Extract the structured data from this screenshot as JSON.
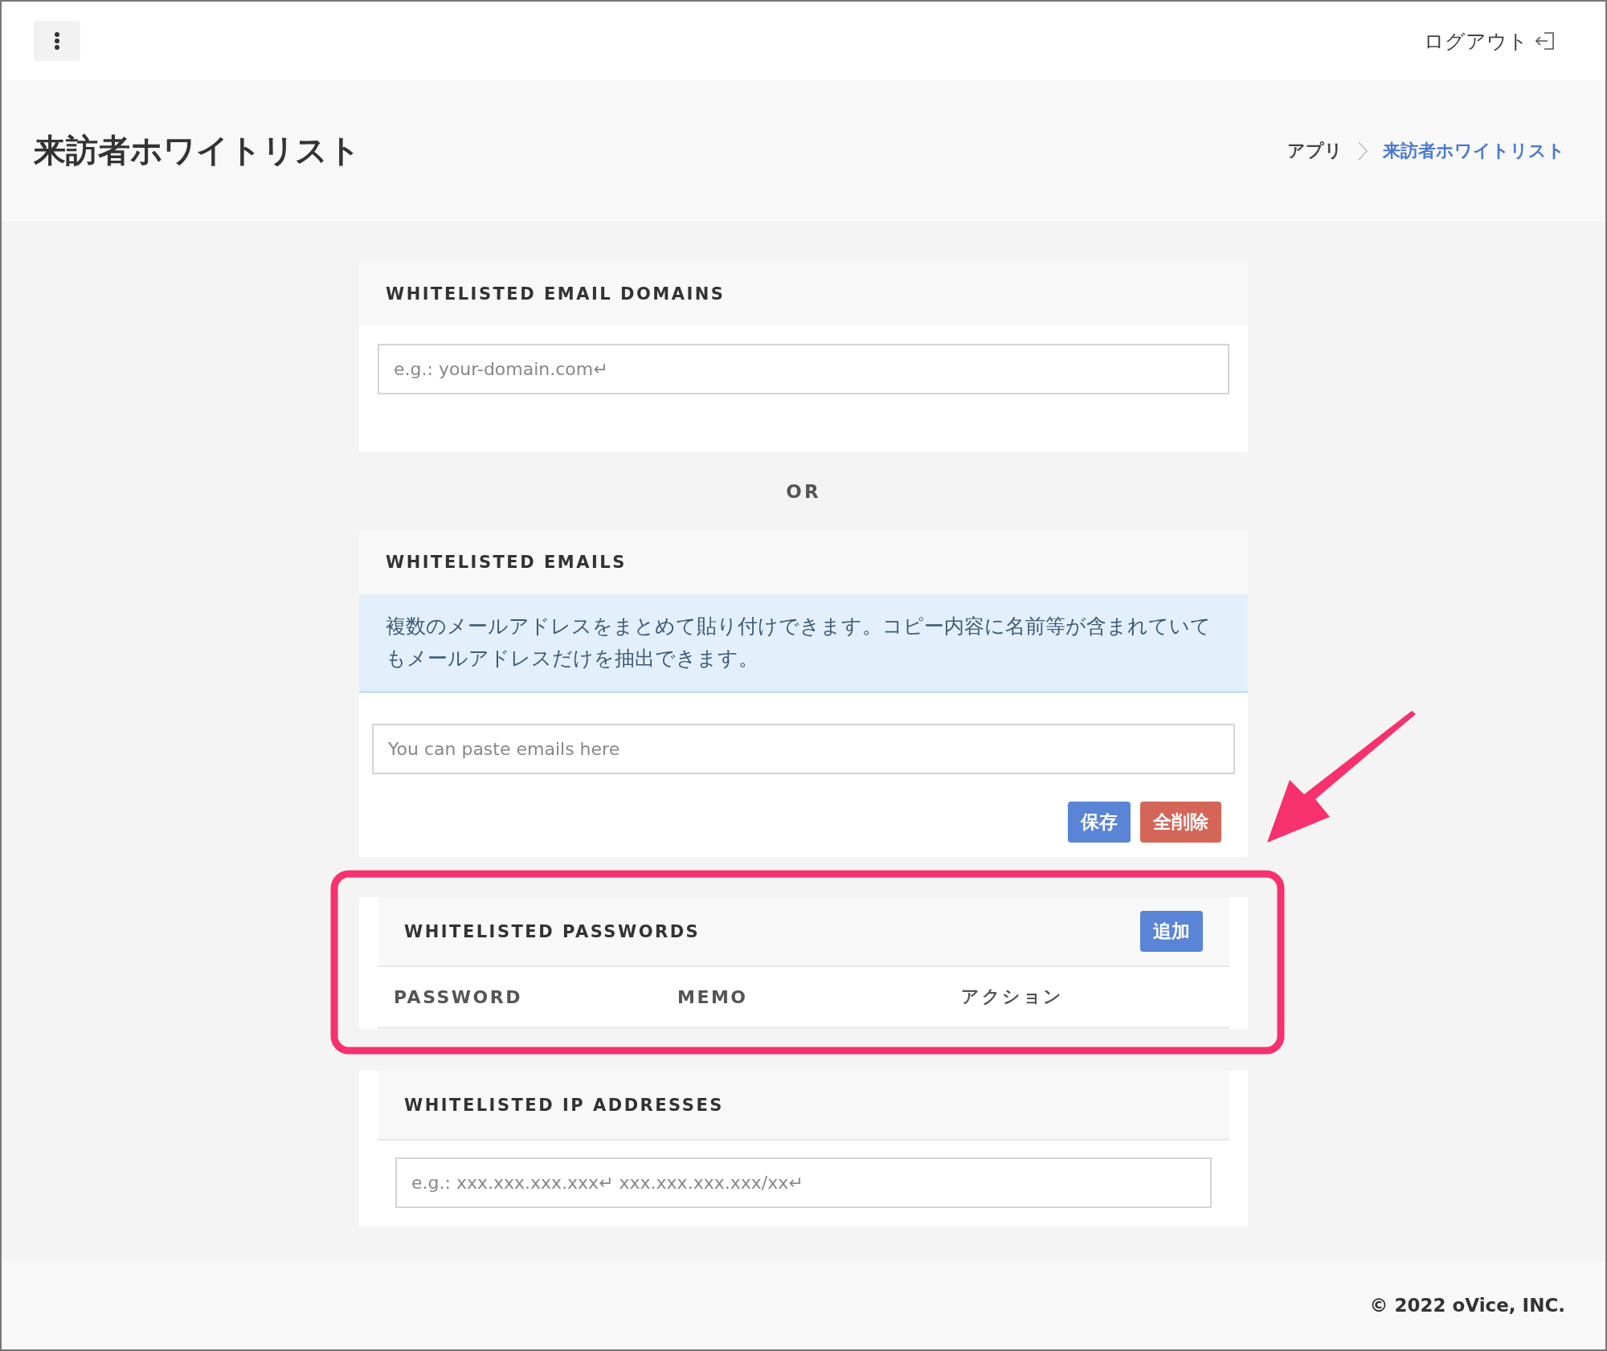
{
  "top_bar": {
    "logout": "ログアウト"
  },
  "header": {
    "title": "来訪者ホワイトリスト",
    "breadcrumb": [
      {
        "label": "アプリ",
        "selected": false
      },
      {
        "label": "来訪者ホワイトリスト",
        "selected": true
      }
    ]
  },
  "domains": {
    "title": "WHITELISTED EMAIL DOMAINS",
    "placeholder": "e.g.: your-domain.com↵"
  },
  "separator": "OR",
  "emails": {
    "title": "WHITELISTED EMAILS",
    "notice": "複数のメールアドレスをまとめて貼り付けできます。コピー内容に名前等が含まれていてもメールアドレスだけを抽出できます。",
    "placeholder": "You can paste emails here",
    "buttons": [
      {
        "label": "保存",
        "kind": "primary"
      },
      {
        "label": "全削除",
        "kind": "danger"
      }
    ]
  },
  "passwords": {
    "title": "WHITELISTED PASSWORDS",
    "add_button": "追加",
    "columns": [
      "PASSWORD",
      "MEMO",
      "アクション"
    ]
  },
  "ip_addresses": {
    "title": "WHITELISTED IP ADDRESSES",
    "placeholder": "e.g.: xxx.xxx.xxx.xxx↵ xxx.xxx.xxx.xxx/xx↵"
  },
  "footer": "© 2022 oVice, INC."
}
